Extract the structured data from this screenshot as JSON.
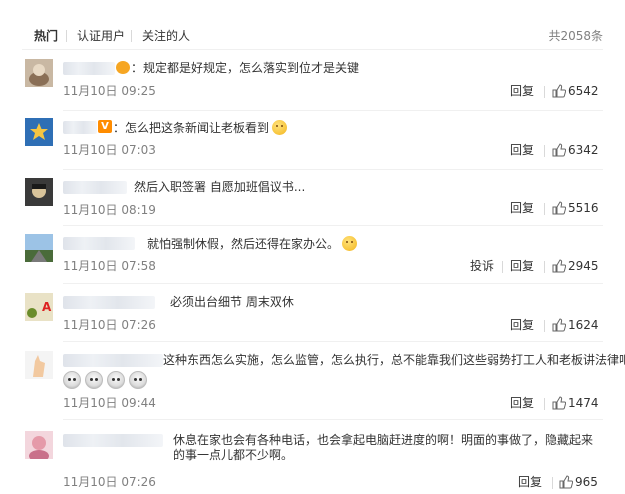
{
  "tabs": [
    {
      "label": "热门",
      "active": true
    },
    {
      "label": "认证用户",
      "active": false
    },
    {
      "label": "关注的人",
      "active": false
    }
  ],
  "total_count": "共2058条",
  "actions": {
    "reply": "回复",
    "report": "投诉"
  },
  "comments": [
    {
      "text": "规定都是好规定，怎么落实到位才是关键",
      "time": "11月10日 09:25",
      "likes": "6542"
    },
    {
      "text": "怎么把这条新闻让老板看到",
      "time": "11月10日 07:03",
      "likes": "6342"
    },
    {
      "text": "然后入职签署 自愿加班倡议书...",
      "time": "11月10日 08:19",
      "likes": "5516"
    },
    {
      "text": "就怕强制休假，然后还得在家办公。",
      "time": "11月10日 07:58",
      "likes": "2945"
    },
    {
      "text": "必须出台细节 周末双休",
      "time": "11月10日 07:26",
      "likes": "1624"
    },
    {
      "text": "这种东西怎么实施，怎么监管，怎么执行，总不能靠我们这些弱势打工人和老板讲法律吧",
      "time": "11月10日 09:44",
      "likes": "1474"
    },
    {
      "text": "休息在家也会有各种电话，也会拿起电脑赶进度的啊！明面的事做了，隐藏起来的事一点儿都不少啊。",
      "time": "11月10日 07:26",
      "likes": "965"
    }
  ],
  "colors": {
    "text": "#333333",
    "muted": "#808080",
    "divider": "#f0f0f0",
    "vip": "#ff8c00"
  }
}
